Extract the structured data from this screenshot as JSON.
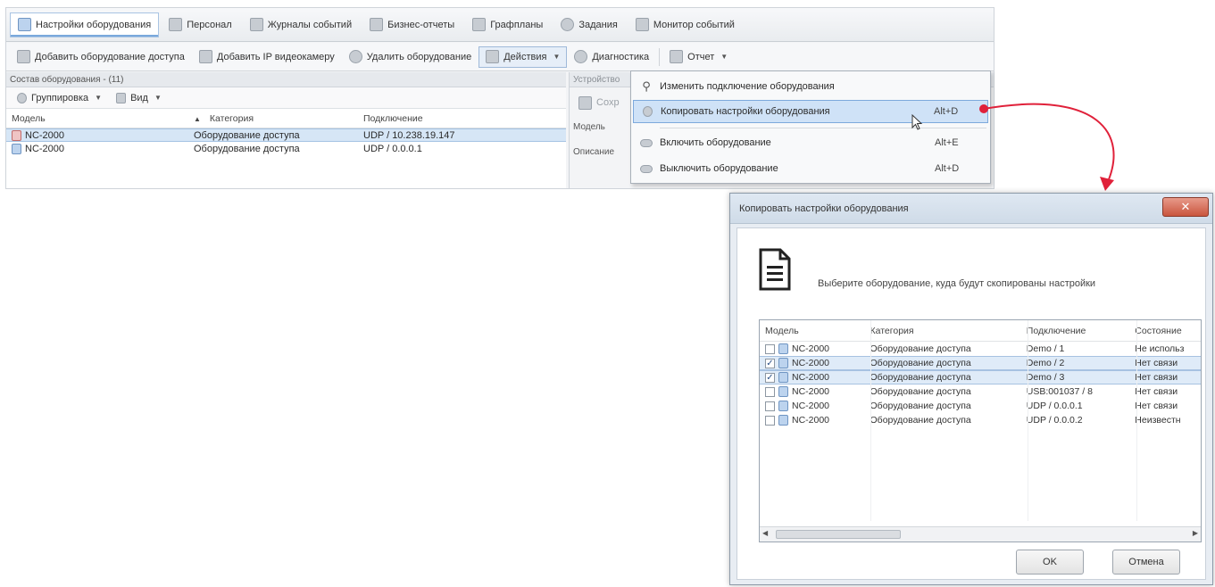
{
  "tabs": [
    {
      "label": "Настройки оборудования",
      "icon": "hardware-settings-icon"
    },
    {
      "label": "Персонал",
      "icon": "staff-icon"
    },
    {
      "label": "Журналы событий",
      "icon": "event-log-icon"
    },
    {
      "label": "Бизнес-отчеты",
      "icon": "business-report-icon"
    },
    {
      "label": "Графпланы",
      "icon": "floorplan-icon"
    },
    {
      "label": "Задания",
      "icon": "tasks-icon"
    },
    {
      "label": "Монитор событий",
      "icon": "event-monitor-icon"
    }
  ],
  "toolbar": {
    "add_access": "Добавить оборудование доступа",
    "add_camera": "Добавить IP видеокамеру",
    "delete": "Удалить оборудование",
    "actions": "Действия",
    "diagnostics": "Диагностика",
    "report": "Отчет"
  },
  "left_pane": {
    "header": "Состав оборудования - (11)",
    "grouping": "Группировка",
    "view": "Вид",
    "columns": [
      "Модель",
      "Категория",
      "Подключение"
    ],
    "rows": [
      {
        "model": "NC-2000",
        "category": "Оборудование доступа",
        "connection": "UDP / 10.238.19.147"
      },
      {
        "model": "NC-2000",
        "category": "Оборудование доступа",
        "connection": "UDP / 0.0.0.1"
      }
    ]
  },
  "right_pane": {
    "header": "Устройство",
    "button": "Сохр",
    "label_model": "Модель",
    "label_desc": "Описание"
  },
  "menu": {
    "items": [
      {
        "label": "Изменить подключение оборудования",
        "shortcut": ""
      },
      {
        "label": "Копировать настройки оборудования",
        "shortcut": "Alt+D"
      },
      {
        "label": "Включить оборудование",
        "shortcut": "Alt+E"
      },
      {
        "label": "Выключить оборудование",
        "shortcut": "Alt+D"
      }
    ]
  },
  "dialog": {
    "title": "Копировать настройки оборудования",
    "close": "✕",
    "prompt": "Выберите оборудование, куда будут скопированы настройки",
    "columns": [
      "Модель",
      "Категория",
      "Подключение",
      "Состояние"
    ],
    "rows": [
      {
        "checked": false,
        "model": "NC-2000",
        "category": "Оборудование доступа",
        "connection": "Demo / 1",
        "state": "Не использ"
      },
      {
        "checked": true,
        "model": "NC-2000",
        "category": "Оборудование доступа",
        "connection": "Demo / 2",
        "state": "Нет связи"
      },
      {
        "checked": true,
        "model": "NC-2000",
        "category": "Оборудование доступа",
        "connection": "Demo / 3",
        "state": "Нет связи"
      },
      {
        "checked": false,
        "model": "NC-2000",
        "category": "Оборудование доступа",
        "connection": "USB:001037 / 8",
        "state": "Нет связи"
      },
      {
        "checked": false,
        "model": "NC-2000",
        "category": "Оборудование доступа",
        "connection": "UDP / 0.0.0.1",
        "state": "Нет связи"
      },
      {
        "checked": false,
        "model": "NC-2000",
        "category": "Оборудование доступа",
        "connection": "UDP / 0.0.0.2",
        "state": "Неизвестн"
      }
    ],
    "ok": "OK",
    "cancel": "Отмена"
  },
  "colors": {
    "accent": "#7aa9dc",
    "highlight": "#cfe2f7",
    "arrow": "#e0213a"
  }
}
